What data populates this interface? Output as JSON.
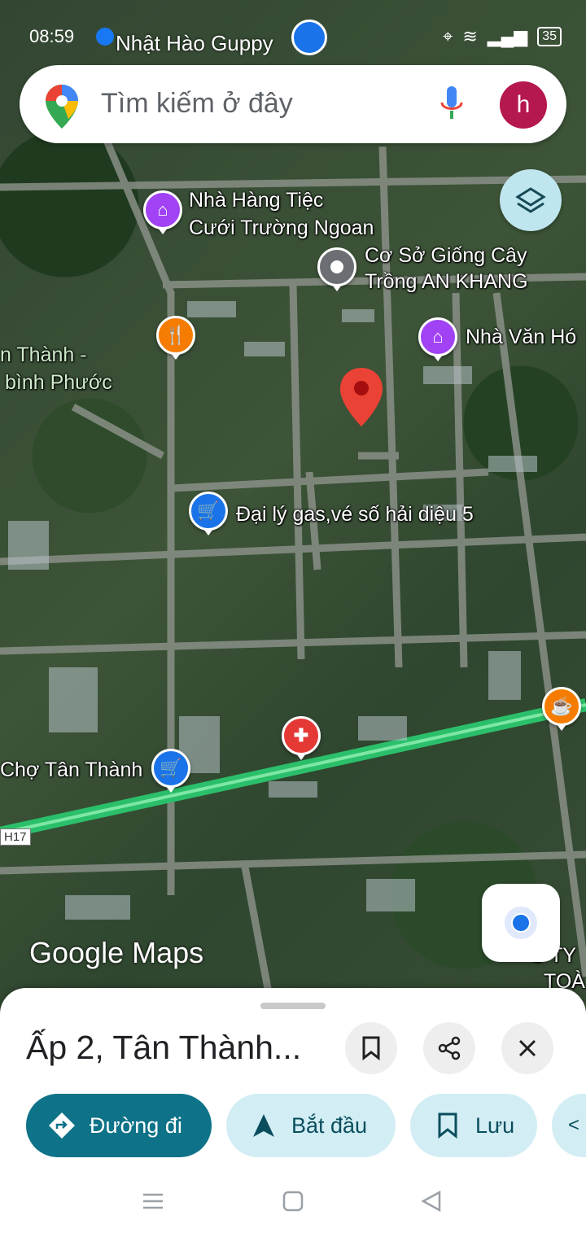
{
  "status_bar": {
    "time": "08:59",
    "notification_text": "Nhật Hào Guppy",
    "battery": "35"
  },
  "search": {
    "placeholder": "Tìm kiếm ở đây",
    "avatar_letter": "h"
  },
  "map": {
    "labels": [
      {
        "text": "Nhà Hàng Tiệc",
        "icon": "event-venue-icon"
      },
      {
        "text": "Cưới Trường Ngoan"
      },
      {
        "text": "Cơ Sở Giống Cây",
        "icon": "place-pin-icon"
      },
      {
        "text": "Trồng AN KHANG"
      },
      {
        "text": "Nhà Văn Hó",
        "icon": "landmark-icon"
      },
      {
        "text": "n Thành -"
      },
      {
        "text": "bình Phước"
      },
      {
        "text": "Đại lý gas,vé số hải diệu 5",
        "icon": "shopping-cart-icon"
      },
      {
        "text": "Chợ Tân Thành",
        "icon": "shopping-cart-icon"
      },
      {
        "text": "G TY"
      },
      {
        "text": "TOÀ"
      }
    ],
    "road_label": "H17",
    "brand": "Google Maps"
  },
  "sheet": {
    "title": "Ấp 2, Tân Thành...",
    "actions": {
      "directions": "Đường đi",
      "start": "Bắt đầu",
      "save": "Lưu"
    }
  },
  "colors": {
    "primary": "#0e7288",
    "secondary": "#d2eef4",
    "pin_red": "#ea4335",
    "restaurant_orange": "#f57c00",
    "venue_purple": "#a142f4",
    "shop_blue": "#1a73e8",
    "avatar": "#b5174f"
  }
}
